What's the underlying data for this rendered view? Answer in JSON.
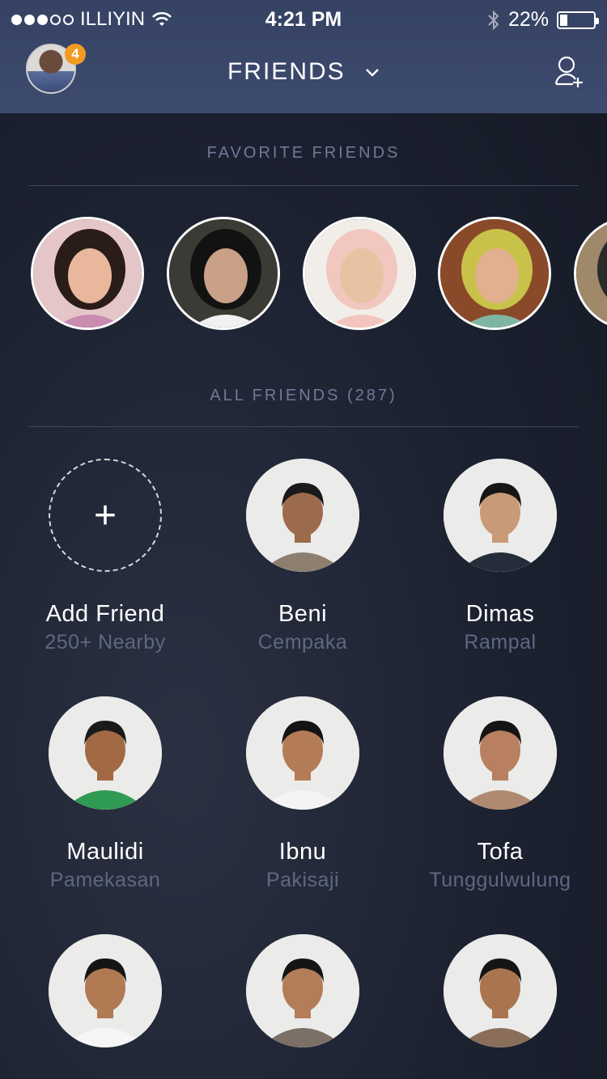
{
  "status": {
    "carrier": "ILLIYIN",
    "time": "4:21 PM",
    "battery": "22%",
    "battery_level": 0.22
  },
  "nav": {
    "title": "FRIENDS",
    "notification_count": "4"
  },
  "sections": {
    "favorites": "FAVORITE FRIENDS",
    "all": "ALL FRIENDS (287)"
  },
  "favorites": [
    {
      "hair": "#2a1d18",
      "skin": "#e8b79c",
      "bg": "#e5c6c8",
      "accent": "#c98bb0"
    },
    {
      "hair": "#121212",
      "skin": "#caa088",
      "bg": "#3b3b35",
      "accent": "#f1f1f1"
    },
    {
      "hair": "#f2c7c0",
      "skin": "#e9c2a4",
      "bg": "#f1eee9",
      "accent": "#f4c5be"
    },
    {
      "hair": "#c8c24a",
      "skin": "#e1b08e",
      "bg": "#8a4a2a",
      "accent": "#7fb6a2"
    },
    {
      "hair": "#2a2a2a",
      "skin": "#c99a78",
      "bg": "#a0886a",
      "accent": "#444444"
    }
  ],
  "add_friend": {
    "name": "Add Friend",
    "subtitle": "250+ Nearby"
  },
  "friends": [
    {
      "name": "Beni",
      "location": "Cempaka",
      "shirt": "#8d7f70",
      "skin": "#9c6b4d",
      "hair": "#1a1a1a"
    },
    {
      "name": "Dimas",
      "location": "Rampal",
      "shirt": "#252c3a",
      "skin": "#c99a78",
      "hair": "#151515"
    },
    {
      "name": "Maulidi",
      "location": "Pamekasan",
      "shirt": "#2f9a52",
      "skin": "#a26a44",
      "hair": "#1a1a1a"
    },
    {
      "name": "Ibnu",
      "location": "Pakisaji",
      "shirt": "#f4f4f4",
      "skin": "#b47c56",
      "hair": "#141414"
    },
    {
      "name": "Tofa",
      "location": "Tunggulwulung",
      "shirt": "#b08a70",
      "skin": "#b88060",
      "hair": "#141414"
    },
    {
      "name": "",
      "location": "",
      "shirt": "#f6f6f6",
      "skin": "#b07a52",
      "hair": "#151515"
    },
    {
      "name": "",
      "location": "",
      "shirt": "#7b6f66",
      "skin": "#b37d5a",
      "hair": "#151515"
    },
    {
      "name": "",
      "location": "",
      "shirt": "#8a6e5a",
      "skin": "#a9754f",
      "hair": "#151515"
    }
  ],
  "colors": {
    "header": "#3a4769",
    "badge": "#f39a22",
    "section_label": "#6e7a98",
    "subtitle": "#5d6882"
  }
}
